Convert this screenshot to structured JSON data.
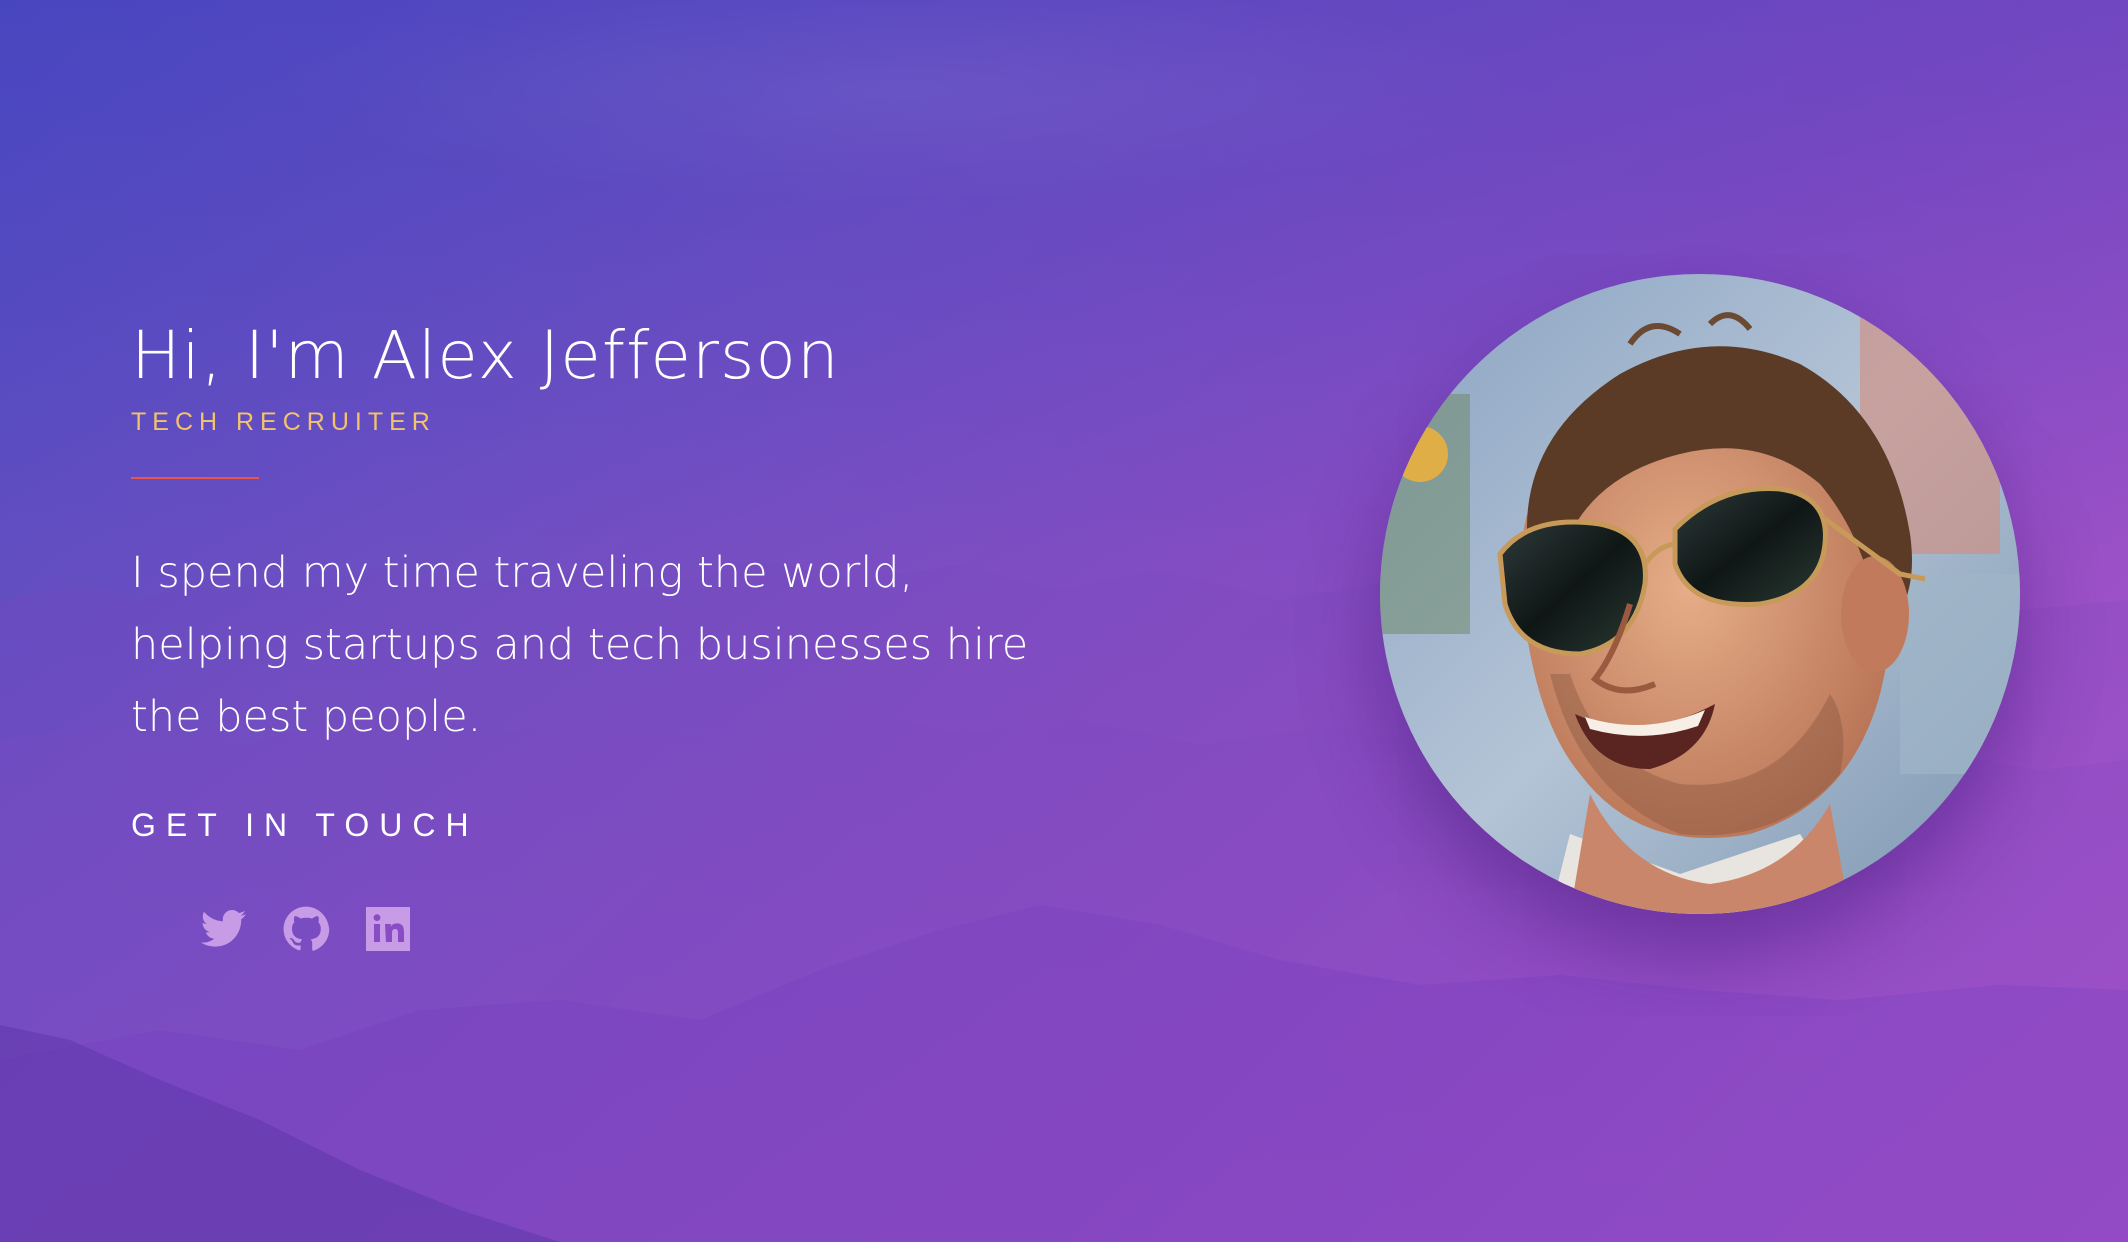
{
  "hero": {
    "title": "Hi, I'm Alex Jefferson",
    "subtitle": "TECH RECRUITER",
    "bio": "I spend my time traveling the world, helping startups and tech businesses hire the best people.",
    "cta_label": "GET IN TOUCH"
  },
  "social": [
    {
      "name": "twitter-icon"
    },
    {
      "name": "github-icon"
    },
    {
      "name": "linkedin-icon"
    }
  ],
  "colors": {
    "accent": "#e8564a",
    "subtitle": "#f2c36b",
    "icon": "#c79be6",
    "gradient_start": "#4f4cc0",
    "gradient_end": "#b155cc"
  },
  "avatar": {
    "icon": "profile-photo"
  }
}
